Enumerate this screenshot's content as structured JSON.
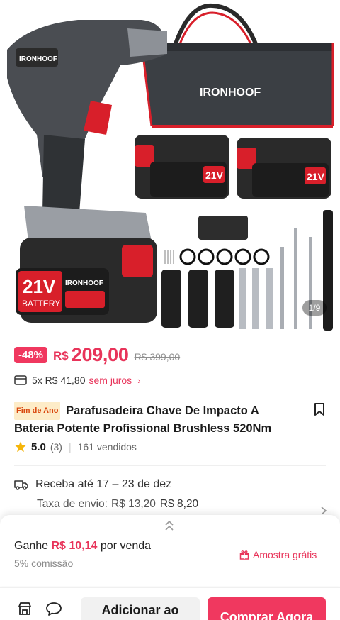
{
  "brand": "IRONHOOF",
  "gallery": {
    "counter": "1/9",
    "battery_voltage": "21V",
    "battery_label": "BATTERY"
  },
  "price": {
    "discount": "-48%",
    "currency": "R$",
    "current": "209,00",
    "original": "R$ 399,00"
  },
  "installment": {
    "text": "5x R$ 41,80",
    "free_label": "sem juros",
    "chevron": "›"
  },
  "product": {
    "tag": "Fim de Ano",
    "title": "Parafusadeira Chave De Impacto A Bateria Potente Profissional Brushless 520Nm",
    "rating": "5.0",
    "reviews": "(3)",
    "sold": "161 vendidos"
  },
  "shipping": {
    "delivery": "Receba até 17 – 23 de dez",
    "fee_label": "Taxa de envio:",
    "fee_old": "R$ 13,20",
    "fee_new": "R$ 8,20"
  },
  "affiliate": {
    "earn_prefix": "Ganhe",
    "earn_amount": "R$ 10,14",
    "earn_suffix": "por venda",
    "commission": "5% comissão",
    "sample": "Amostra grátis"
  },
  "actions": {
    "add_to_cart": "Adicionar ao",
    "buy_now": "Comprar Agora"
  },
  "colors": {
    "accent": "#e8345a",
    "discount_bg": "#f0385f",
    "tag_bg": "#fdecc8",
    "tag_text": "#d9480f"
  }
}
